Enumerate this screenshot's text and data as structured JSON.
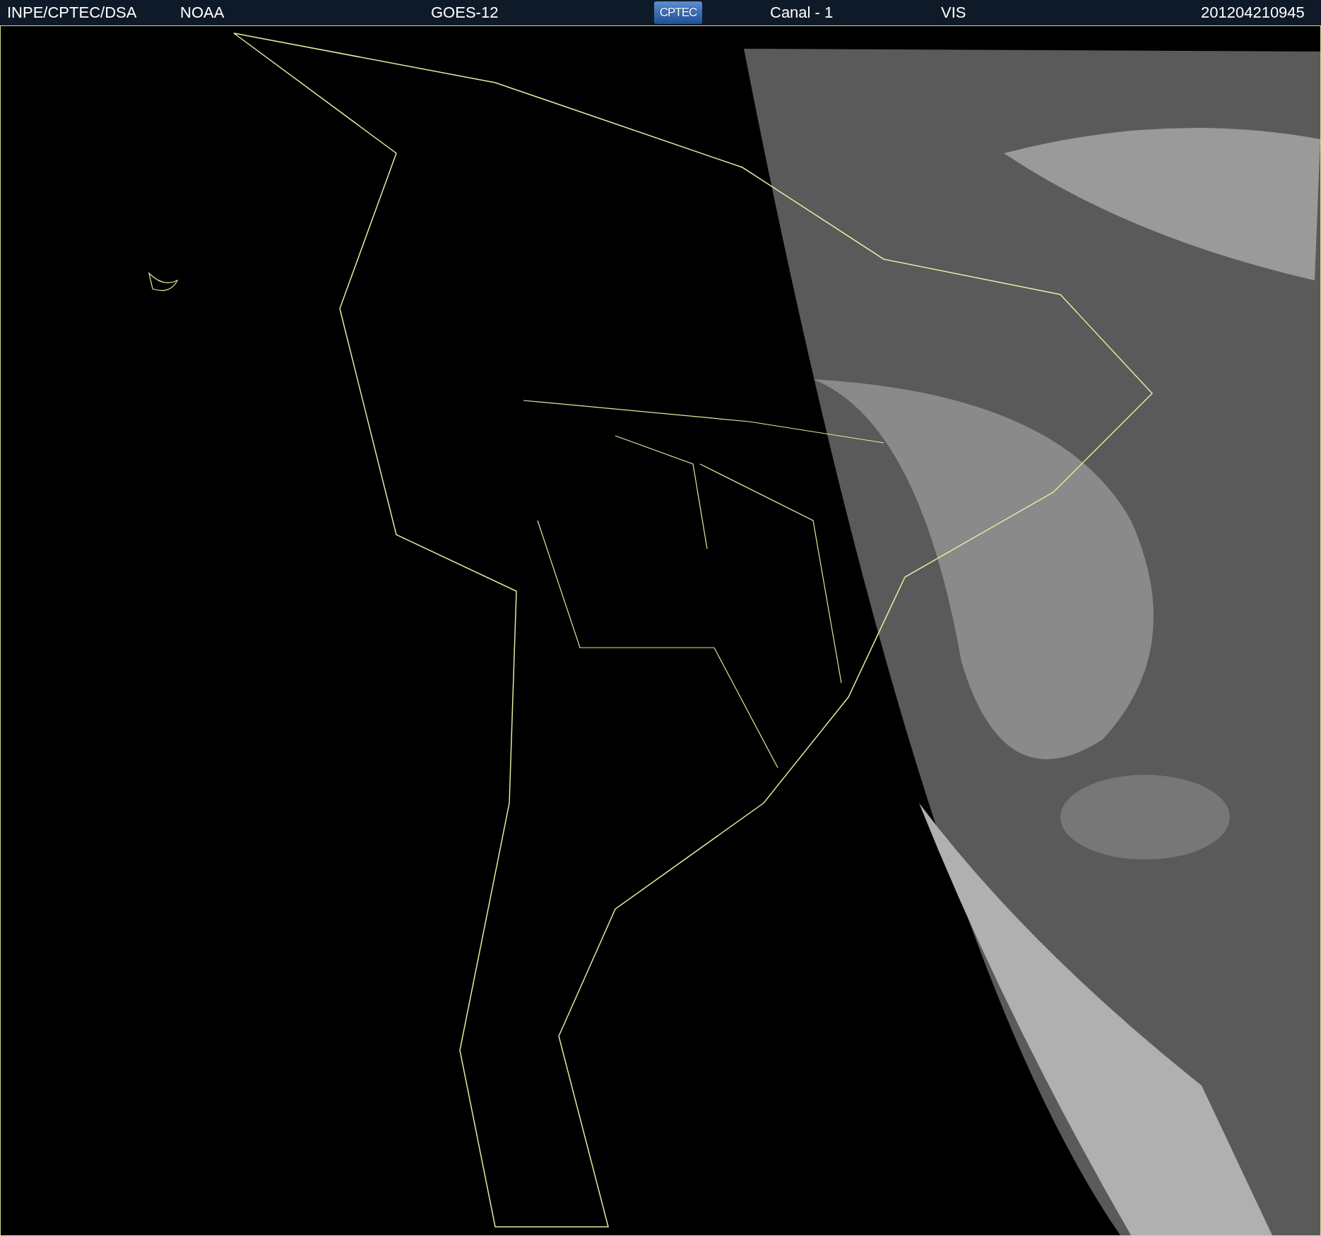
{
  "header": {
    "source": "INPE/CPTEC/DSA",
    "agency": "NOAA",
    "satellite": "GOES-12",
    "logo": "CPTEC",
    "channel": "Canal - 1",
    "band": "VIS",
    "timestamp": "201204210945"
  }
}
